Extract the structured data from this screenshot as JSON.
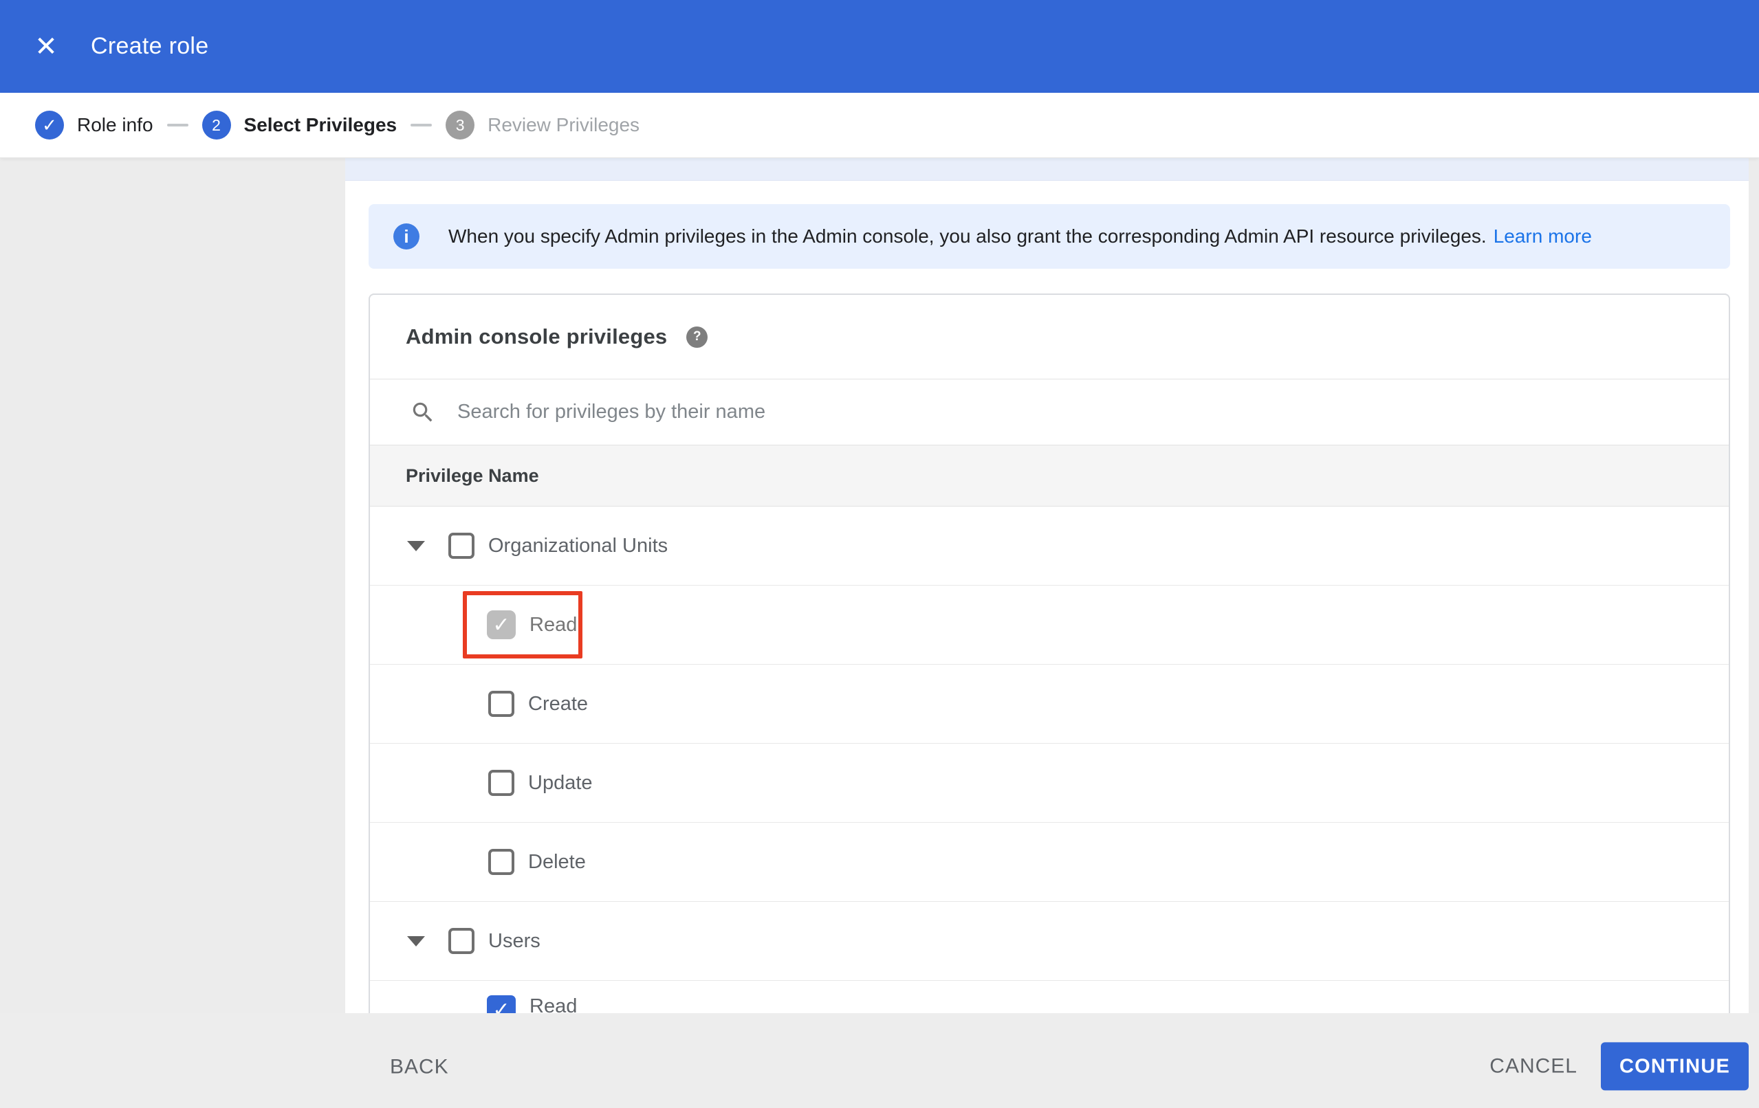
{
  "header": {
    "title": "Create role"
  },
  "stepper": {
    "steps": [
      {
        "number": "1",
        "label": "Role info",
        "state": "complete"
      },
      {
        "number": "2",
        "label": "Select Privileges",
        "state": "active"
      },
      {
        "number": "3",
        "label": "Review Privileges",
        "state": "upcoming"
      }
    ]
  },
  "banner": {
    "text": "When you specify Admin privileges in the Admin console, you also grant the corresponding Admin API resource privileges.",
    "link_label": "Learn more"
  },
  "privileges_card": {
    "title": "Admin console privileges",
    "search_placeholder": "Search for privileges by their name",
    "column_header": "Privilege Name",
    "rows": [
      {
        "label": "Organizational Units",
        "type": "group",
        "checked": false
      },
      {
        "label": "Read",
        "type": "child",
        "checked": true,
        "style": "gray",
        "highlighted": true
      },
      {
        "label": "Create",
        "type": "child",
        "checked": false
      },
      {
        "label": "Update",
        "type": "child",
        "checked": false
      },
      {
        "label": "Delete",
        "type": "child",
        "checked": false
      },
      {
        "label": "Users",
        "type": "group",
        "checked": false
      },
      {
        "label": "Read",
        "type": "child",
        "checked": true,
        "style": "blue"
      }
    ]
  },
  "footer": {
    "back_label": "BACK",
    "cancel_label": "CANCEL",
    "continue_label": "CONTINUE"
  },
  "icons": {
    "close": "✕",
    "check": "✓",
    "info": "i",
    "help": "?"
  },
  "colors": {
    "primary_blue": "#3367d6",
    "banner_bg": "#e8f0fe",
    "link_blue": "#1a73e8",
    "highlight_red": "#e93c22",
    "checked_gray": "#bdbdbd",
    "step_upcoming_gray": "#9e9e9e"
  }
}
